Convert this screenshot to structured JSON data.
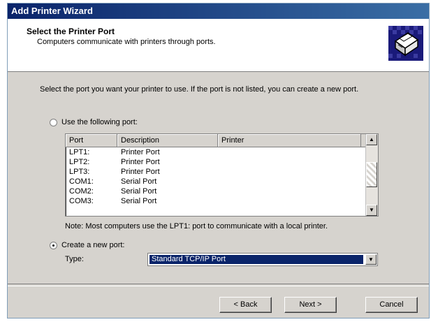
{
  "window": {
    "title": "Add Printer Wizard"
  },
  "header": {
    "title": "Select the Printer Port",
    "subtitle": "Computers communicate with printers through ports.",
    "icon": "printer-port-icon"
  },
  "intro": "Select the port you want your printer to use. If the port is not listed, you can create a new port.",
  "options": {
    "use_existing_label": "Use the following port:",
    "create_new_label": "Create a new port:",
    "selected": "create_new"
  },
  "port_table": {
    "columns": [
      "Port",
      "Description",
      "Printer"
    ],
    "rows": [
      [
        "LPT1:",
        "Printer Port",
        ""
      ],
      [
        "LPT2:",
        "Printer Port",
        ""
      ],
      [
        "LPT3:",
        "Printer Port",
        ""
      ],
      [
        "COM1:",
        "Serial Port",
        ""
      ],
      [
        "COM2:",
        "Serial Port",
        ""
      ],
      [
        "COM3:",
        "Serial Port",
        ""
      ]
    ]
  },
  "note": "Note: Most computers use the LPT1: port to communicate with a local printer.",
  "type_label": "Type:",
  "type_value": "Standard TCP/IP Port",
  "buttons": {
    "back": "< Back",
    "next": "Next >",
    "cancel": "Cancel"
  },
  "colors": {
    "title_bar": "#0a246a",
    "dialog_bg": "#d6d3ce",
    "selection": "#0a246a"
  }
}
